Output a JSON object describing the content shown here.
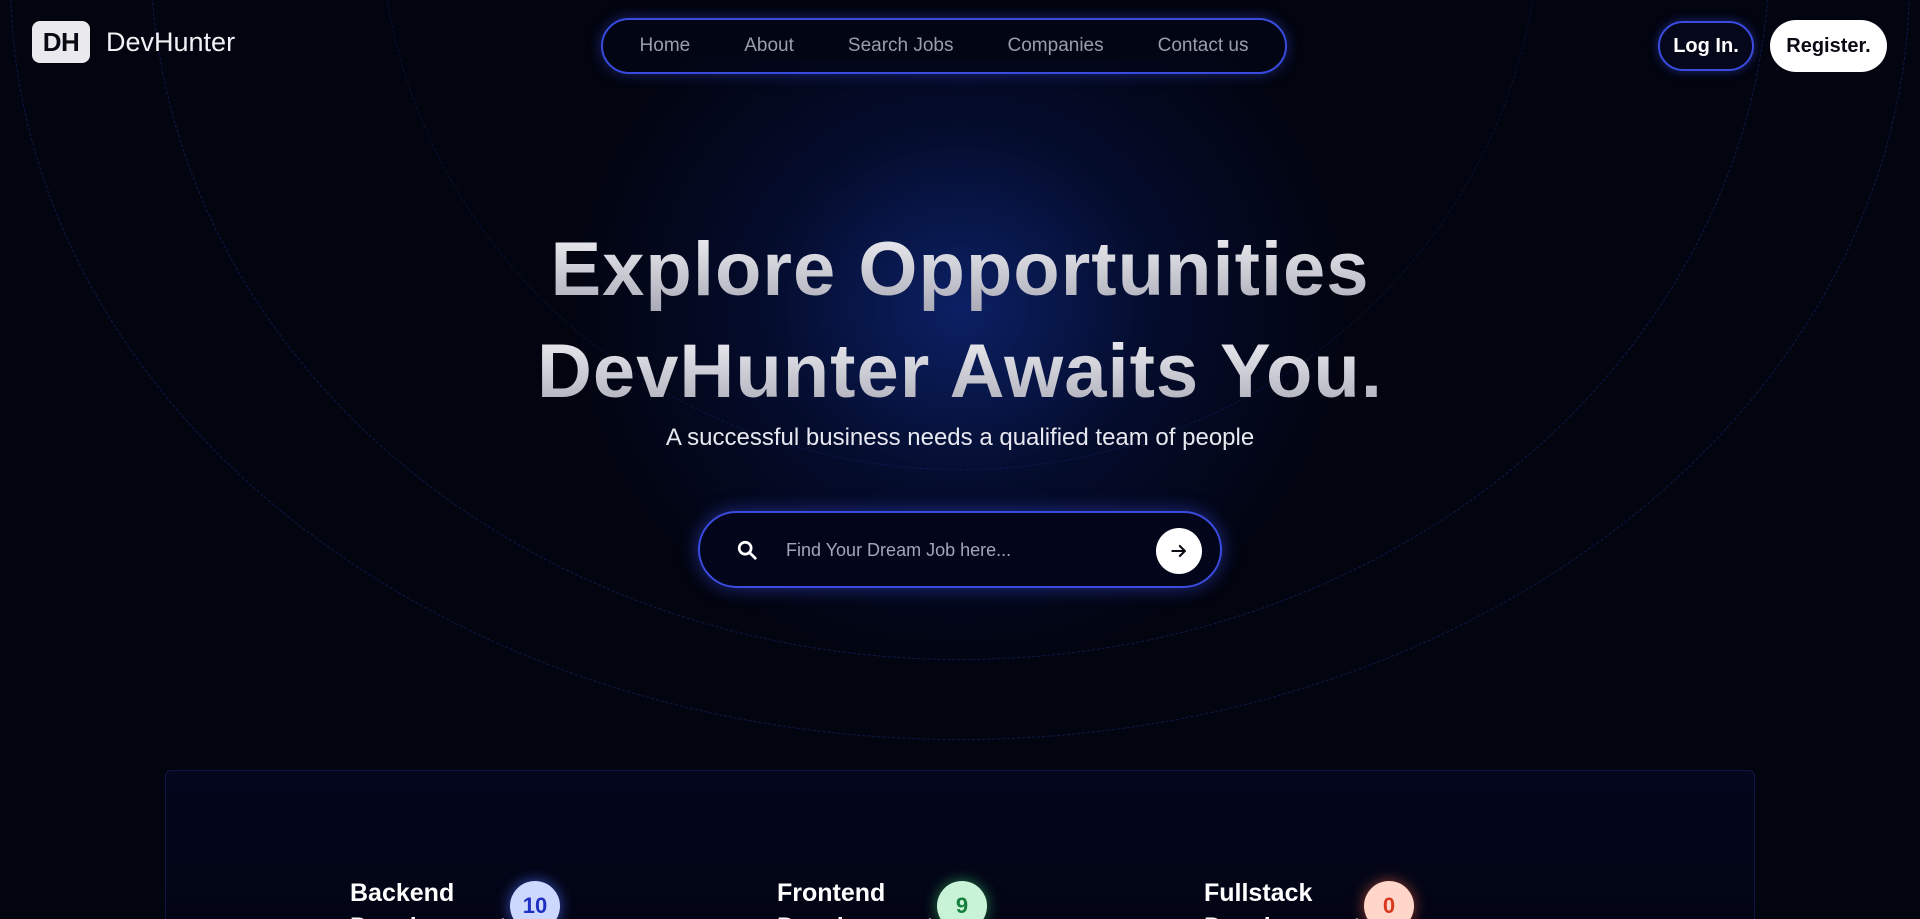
{
  "brand": {
    "logo_mark": "DH",
    "name": "DevHunter"
  },
  "nav": {
    "items": [
      {
        "label": "Home"
      },
      {
        "label": "About"
      },
      {
        "label": "Search Jobs"
      },
      {
        "label": "Companies"
      },
      {
        "label": "Contact us"
      }
    ]
  },
  "auth": {
    "login_label": "Log In.",
    "register_label": "Register."
  },
  "hero": {
    "title_line1": "Explore Opportunities",
    "title_line2": "DevHunter Awaits You.",
    "subtitle": "A successful business needs a qualified team of people"
  },
  "search": {
    "placeholder": "Find Your Dream Job here...",
    "value": "",
    "icon": "search-icon",
    "submit_icon": "arrow-right-icon"
  },
  "categories": [
    {
      "title": "Backend Development",
      "count": "10",
      "badge_bg": "#cdd8ff",
      "badge_fg": "#1f2fc0"
    },
    {
      "title": "Frontend Development",
      "count": "9",
      "badge_bg": "#c9f3d6",
      "badge_fg": "#15803d"
    },
    {
      "title": "Fullstack Development",
      "count": "0",
      "badge_bg": "#ffd6c9",
      "badge_fg": "#d9381e"
    }
  ],
  "colors": {
    "accent": "#3a4be0",
    "background": "#02040f"
  }
}
